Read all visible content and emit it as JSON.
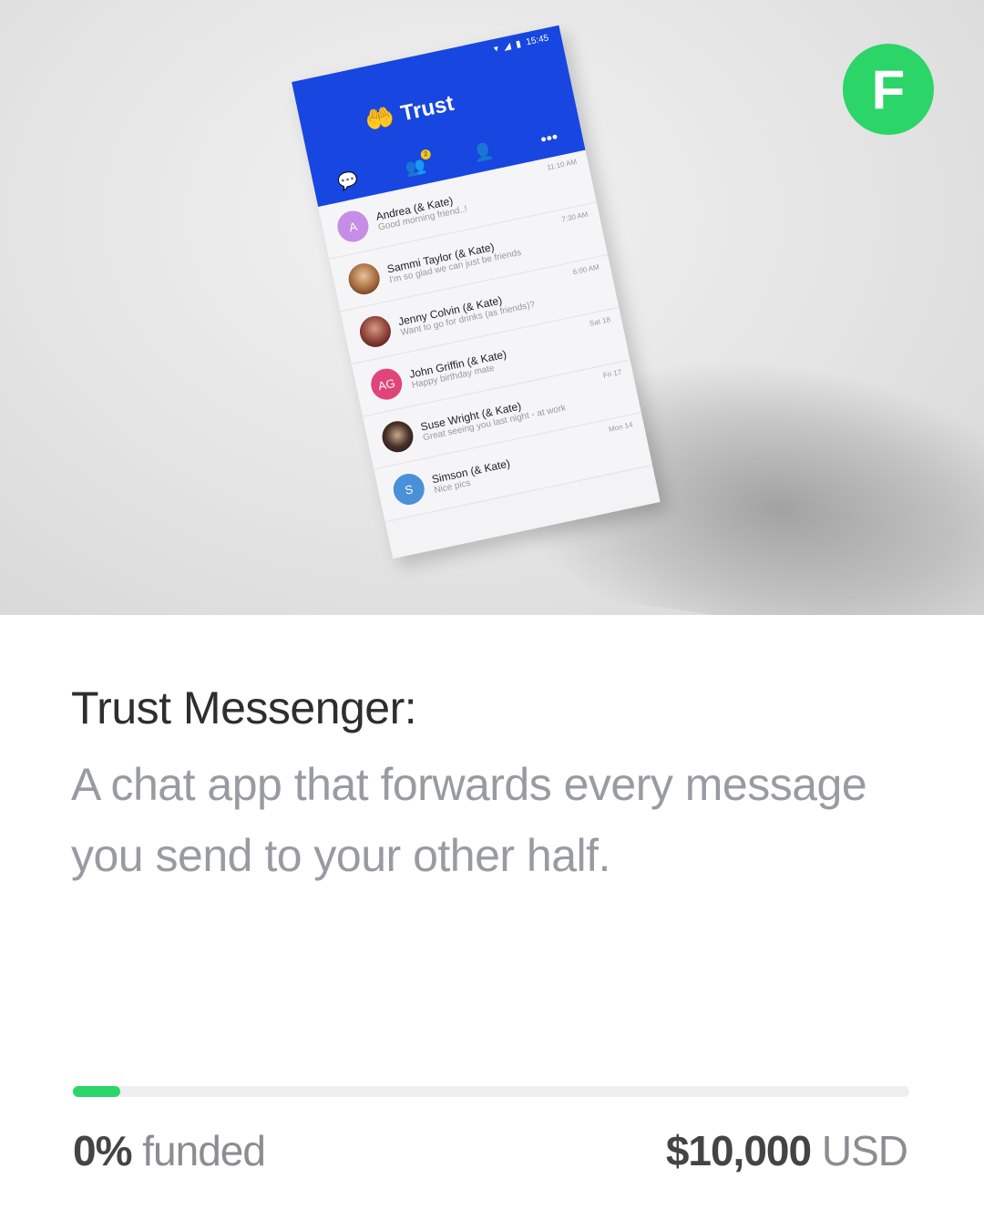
{
  "hero": {
    "logo_letter": "F",
    "logo_color": "#2bd567",
    "phone": {
      "status_time": "15:45",
      "app_name": "Trust",
      "app_color": "#1746e0",
      "tabs": [
        {
          "icon": "chat-bubble-icon"
        },
        {
          "icon": "group-icon",
          "badge": "2"
        },
        {
          "icon": "person-icon"
        },
        {
          "icon": "more-dots-icon"
        }
      ],
      "conversations": [
        {
          "name": "Andrea (& Kate)",
          "preview": "Good morning friend..!",
          "time": "11:10 AM",
          "avatar": "A",
          "avatar_color": "#c68de6"
        },
        {
          "name": "Sammi Taylor (& Kate)",
          "preview": "I'm so glad we can just be friends",
          "time": "7:30 AM",
          "avatar": "",
          "avatar_color": ""
        },
        {
          "name": "Jenny Colvin (& Kate)",
          "preview": "Want to go for drinks (as friends)?",
          "time": "6:00 AM",
          "avatar": "",
          "avatar_color": ""
        },
        {
          "name": "John Griffin (& Kate)",
          "preview": "Happy birthday mate",
          "time": "Sat 18",
          "avatar": "AG",
          "avatar_color": "#e0457a"
        },
        {
          "name": "Suse Wright (& Kate)",
          "preview": "Great seeing you last night - at work",
          "time": "Fri 17",
          "avatar": "",
          "avatar_color": ""
        },
        {
          "name": "Simson (& Kate)",
          "preview": "Nice pics",
          "time": "Mon 14",
          "avatar": "S",
          "avatar_color": "#4a90d9"
        }
      ]
    }
  },
  "project": {
    "title": "Trust Messenger:",
    "description": "A chat app that forwards every message you send to your other half."
  },
  "funding": {
    "percent_label": "0%",
    "funded_label": "funded",
    "progress_fraction": 0.057,
    "progress_color": "#2bd567",
    "goal_amount": "$10,000",
    "currency": "USD"
  }
}
